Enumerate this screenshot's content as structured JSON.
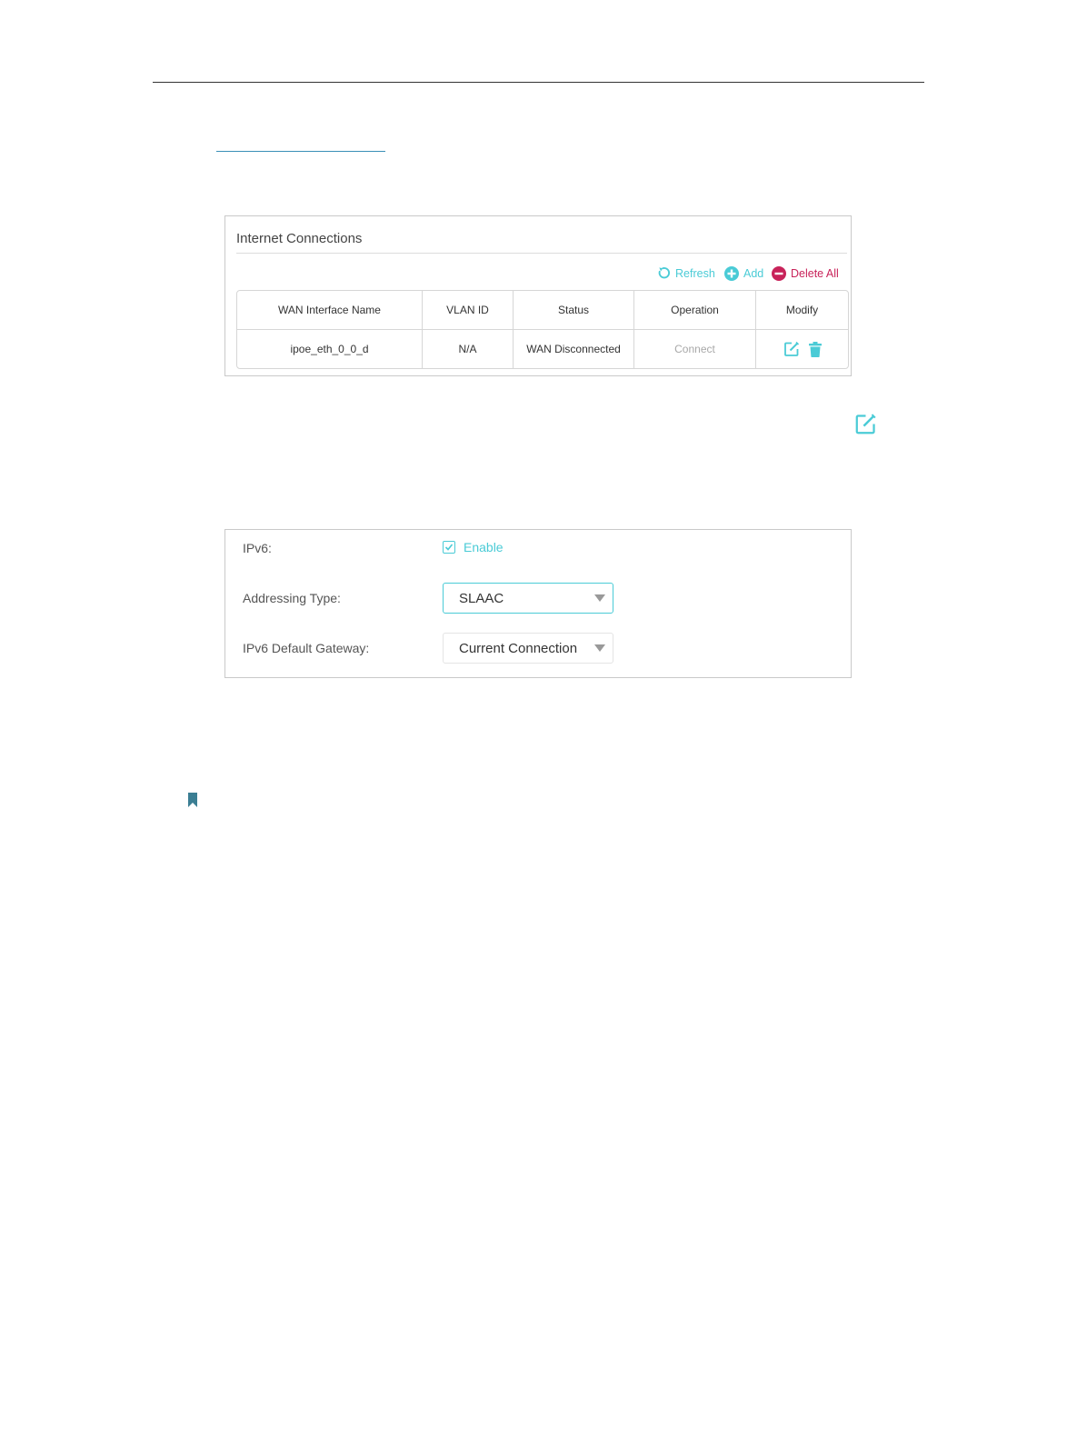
{
  "internet_connections": {
    "title": "Internet Connections",
    "toolbar": {
      "refresh_label": "Refresh",
      "add_label": "Add",
      "delete_all_label": "Delete All"
    },
    "table": {
      "headers": [
        "WAN Interface Name",
        "VLAN ID",
        "Status",
        "Operation",
        "Modify"
      ],
      "rows": [
        {
          "name": "ipoe_eth_0_0_d",
          "vlan_id": "N/A",
          "status": "WAN Disconnected",
          "operation": "Connect"
        }
      ]
    }
  },
  "ipv6_settings": {
    "ipv6_label": "IPv6:",
    "enable_label": "Enable",
    "enable_checked": true,
    "addressing_type_label": "Addressing Type:",
    "addressing_type_value": "SLAAC",
    "default_gateway_label": "IPv6 Default Gateway:",
    "default_gateway_value": "Current Connection"
  },
  "colors": {
    "accent": "#4acbd6",
    "danger": "#c8235a",
    "note_marker": "#3b7e93"
  },
  "icons": [
    "refresh-icon",
    "add-icon",
    "delete-all-icon",
    "edit-icon",
    "trash-icon",
    "checkbox-check-icon",
    "chevron-down-icon",
    "bookmark-icon"
  ]
}
